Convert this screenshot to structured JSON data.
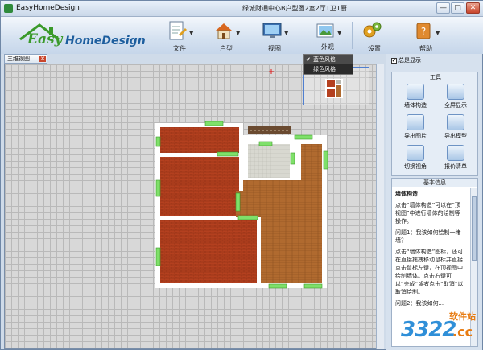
{
  "window": {
    "app_title": "EasyHomeDesign",
    "doc_title": "绿城财通中心B户型图2室2厅1卫1厨",
    "min": "—",
    "max": "□",
    "close": "✕"
  },
  "logo": {
    "easy": "Easy",
    "home_design": "HomeDesign"
  },
  "toolbar": {
    "file": "文件",
    "layout": "户型",
    "view": "视图",
    "appearance": "外观",
    "settings": "设置",
    "help": "帮助"
  },
  "view_tab": {
    "label": "三维视图",
    "close": "✕"
  },
  "appearance_menu": {
    "options": [
      {
        "label": "蓝色风格",
        "checked": true
      },
      {
        "label": "绿色风格",
        "checked": false
      }
    ],
    "check_mark": "✔"
  },
  "panel": {
    "show_all": "总是显示",
    "show_all_checked": true,
    "tools_header": "工具",
    "tools": [
      "墙体构造",
      "全屏显示",
      "导出图片",
      "导出模型",
      "切换视角",
      "报价清单"
    ],
    "info_header": "基本信息",
    "info_title": "墙体构造",
    "info_paragraphs": [
      "点击“墙体构造”可以在“顶视图”中进行墙体的绘制等操作。",
      "问题1：我该如何绘制一堵墙？",
      "点击“墙体构造”图标，还可在直接拖拽移动鼠标并直接点击鼠标左键，在顶视图中绘制墙体。点击右键可以“完成”或者点击“取消”以取消绘制。",
      "问题2：我该如何..."
    ]
  },
  "watermark": {
    "site": "软件站",
    "number": "3322",
    "tld": ".cc"
  },
  "colors": {
    "accent": "#2f8fd8",
    "floor_red": "#b4401f",
    "floor_wood": "#b06a2f",
    "wall": "#ffffff",
    "window_green": "#7fe06a"
  }
}
